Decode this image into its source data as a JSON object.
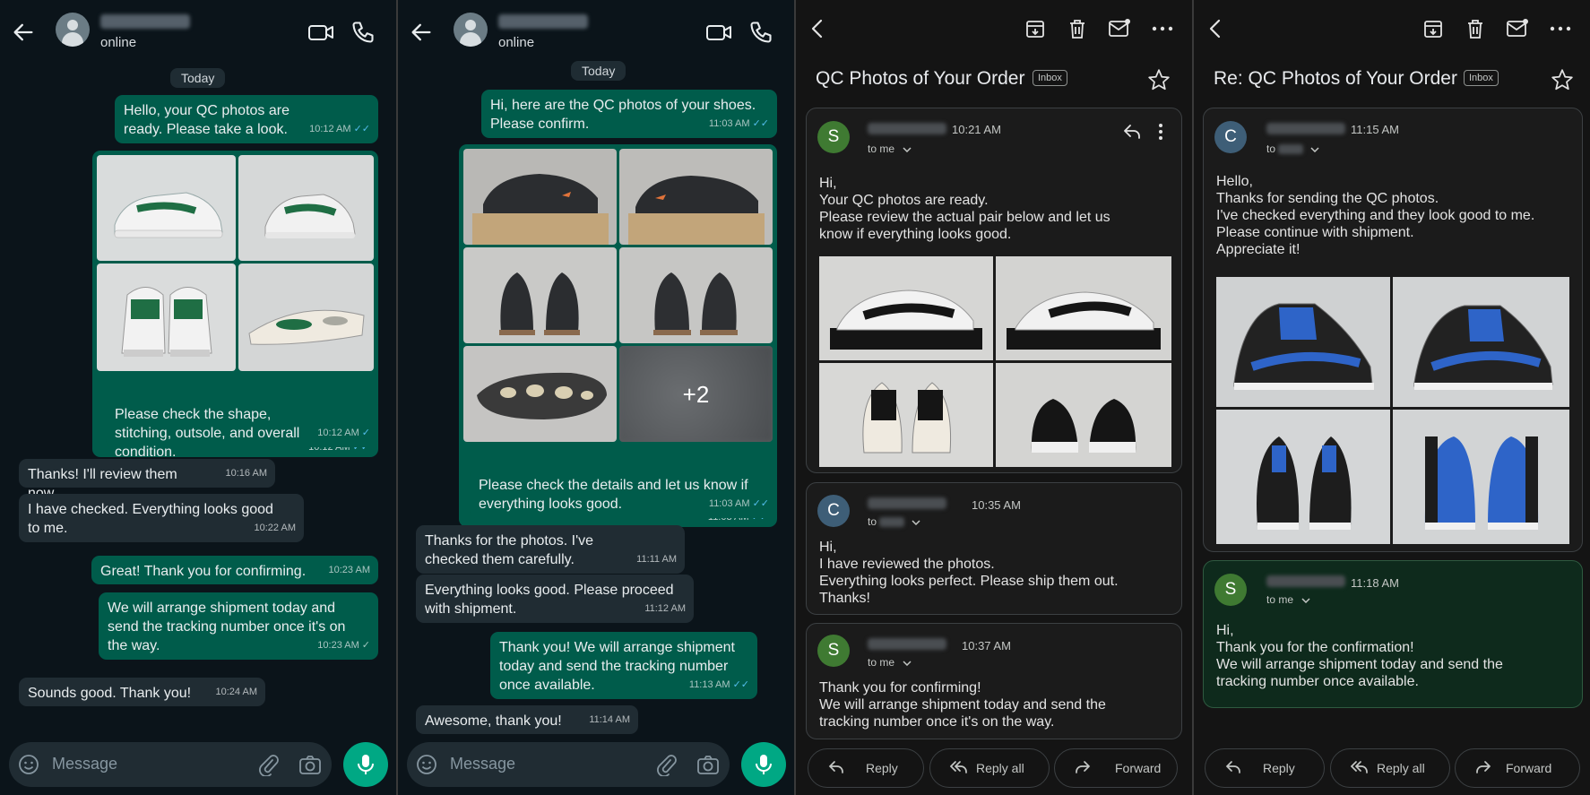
{
  "wa1": {
    "status": "online",
    "day": "Today",
    "m1": {
      "text": "Hello, your QC photos are ready. Please take a look.",
      "time": "10:12 AM",
      "tick": "✓✓"
    },
    "img_time": "10:12 AM",
    "img_tick": "✓✓",
    "m2": {
      "text": "Please check the shape, stitching, outsole, and overall condition.",
      "time": "10:12 AM",
      "tick": "✓"
    },
    "m3": {
      "text": "Thanks! I'll review them now.",
      "time": "10:16 AM"
    },
    "m4": {
      "text": "I have checked. Everything looks good to me.",
      "time": "10:22 AM"
    },
    "m5": {
      "text": "Great! Thank you for confirming.",
      "time": "10:23 AM"
    },
    "m6": {
      "text": "We will arrange shipment today and send the tracking number once it's on the way.",
      "time": "10:23 AM",
      "tick": "✓"
    },
    "m7": {
      "text": "Sounds good. Thank you!",
      "time": "10:24 AM"
    },
    "input_placeholder": "Message"
  },
  "wa2": {
    "status": "online",
    "day": "Today",
    "m1": {
      "text": "Hi, here are the QC photos of your shoes. Please confirm.",
      "time": "11:03 AM",
      "tick": "✓✓"
    },
    "more": "+2",
    "img_time": "11:03 AM",
    "img_tick": "✓✓",
    "m2": {
      "text": "Please check the details and let us know if everything looks good.",
      "time": "11:03 AM",
      "tick": "✓✓"
    },
    "m3": {
      "text": "Thanks for the photos. I've checked them carefully.",
      "time": "11:11 AM"
    },
    "m4": {
      "text": "Everything looks good. Please proceed with shipment.",
      "time": "11:12 AM"
    },
    "m5": {
      "text": "Thank you! We will arrange shipment today and send the tracking number once available.",
      "time": "11:13 AM",
      "tick": "✓✓"
    },
    "m6": {
      "text": "Awesome, thank you!",
      "time": "11:14 AM"
    },
    "input_placeholder": "Message"
  },
  "em1": {
    "subject": "QC Photos of Your Order",
    "badge": "Inbox",
    "c1": {
      "avatar": "S",
      "time": "10:21 AM",
      "to": "to me",
      "body": [
        "Hi,",
        "Your QC photos are ready.",
        "Please review the actual pair below and let us",
        "know if everything looks good."
      ]
    },
    "c2": {
      "avatar": "C",
      "time": "10:35 AM",
      "to": "to",
      "body": [
        "Hi,",
        "I have reviewed the photos.",
        "Everything looks perfect. Please ship them out.",
        "Thanks!"
      ]
    },
    "c3": {
      "avatar": "S",
      "time": "10:37 AM",
      "to": "to me",
      "body": [
        "Thank you for confirming!",
        "We will arrange shipment today and send the",
        "tracking number once it's on the way."
      ]
    },
    "actions": [
      "Reply",
      "Reply all",
      "Forward"
    ]
  },
  "em2": {
    "subject": "Re: QC Photos of Your Order",
    "badge": "Inbox",
    "c1": {
      "avatar": "C",
      "time": "11:15 AM",
      "to": "to",
      "body": [
        "Hello,",
        "Thanks for sending the QC photos.",
        "I've checked everything and they look good to me.",
        "Please continue with shipment.",
        "Appreciate it!"
      ]
    },
    "c2": {
      "avatar": "S",
      "time": "11:18 AM",
      "to": "to me",
      "body": [
        "Hi,",
        "Thank you for the confirmation!",
        "We will arrange shipment today and send the",
        "tracking number once available."
      ]
    },
    "actions": [
      "Reply",
      "Reply all",
      "Forward"
    ]
  },
  "colors": {
    "wa_bg": "#0b141a",
    "wa_out": "#005c4b",
    "wa_in": "#202c33",
    "wa_accent": "#00a884",
    "tick_blue": "#53bdeb",
    "em_bg": "#141414",
    "em_card": "#1b1b1b",
    "em_card_green": "#0e2a1c"
  },
  "icons": [
    "back-arrow-icon",
    "avatar-person-icon",
    "video-call-icon",
    "phone-icon",
    "emoji-icon",
    "attach-icon",
    "camera-icon",
    "mic-icon",
    "archive-icon",
    "trash-icon",
    "mark-unread-icon",
    "more-icon",
    "star-icon",
    "reply-icon",
    "reply-all-icon",
    "forward-icon",
    "chevron-down-icon"
  ]
}
